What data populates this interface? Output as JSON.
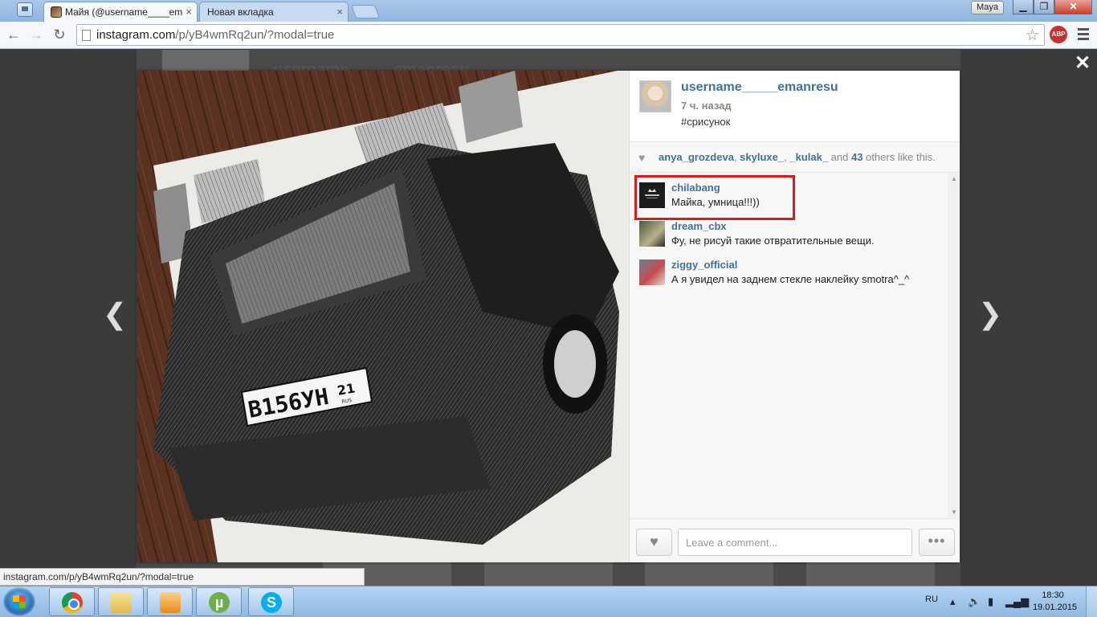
{
  "browser": {
    "tabs": [
      {
        "title": "Майя (@username____em"
      },
      {
        "title": "Новая вкладка"
      }
    ],
    "profile": "Maya",
    "url_host": "instagram.com",
    "url_path": "/p/yB4wmRq2un/?modal=true",
    "abp_label": "ABP",
    "status_url": "instagram.com/p/yB4wmRq2un/?modal=true"
  },
  "background": {
    "name": "username_____emanresu"
  },
  "post": {
    "owner": "username_____emanresu",
    "time": "7 ч. назад",
    "caption": "#срисунок",
    "likes": {
      "user1": "anya_grozdeva",
      "user2": "skyluxe_",
      "user3": "_kulak_",
      "and_word": "and",
      "count": "43",
      "suffix": "others like this."
    },
    "comments": [
      {
        "user": "chilabang",
        "text": "Майка, умница!!!))"
      },
      {
        "user": "dream_cbx",
        "text": "Фу, не рисуй такие отвратительные вещи."
      },
      {
        "user": "ziggy_official",
        "text": "А я увидел на заднем стекле наклейку smotra^_^"
      }
    ],
    "comment_placeholder": "Leave a comment...",
    "more_label": "•••"
  },
  "drawing": {
    "plate_left": "В156УН",
    "plate_region": "21",
    "plate_country": "RUS"
  },
  "taskbar": {
    "lang": "RU",
    "time": "18:30",
    "date": "19.01.2015",
    "torrent_glyph": "µ",
    "skype_glyph": "S"
  },
  "icons": [
    "window-icon",
    "close-tab-icon",
    "back-icon",
    "forward-icon",
    "reload-icon",
    "page-icon",
    "star-icon",
    "menu-icon",
    "close-modal-icon",
    "prev-arrow-icon",
    "next-arrow-icon",
    "heart-icon",
    "start-icon",
    "chrome-icon",
    "explorer-icon",
    "media-icon",
    "utorrent-icon",
    "skype-icon"
  ]
}
